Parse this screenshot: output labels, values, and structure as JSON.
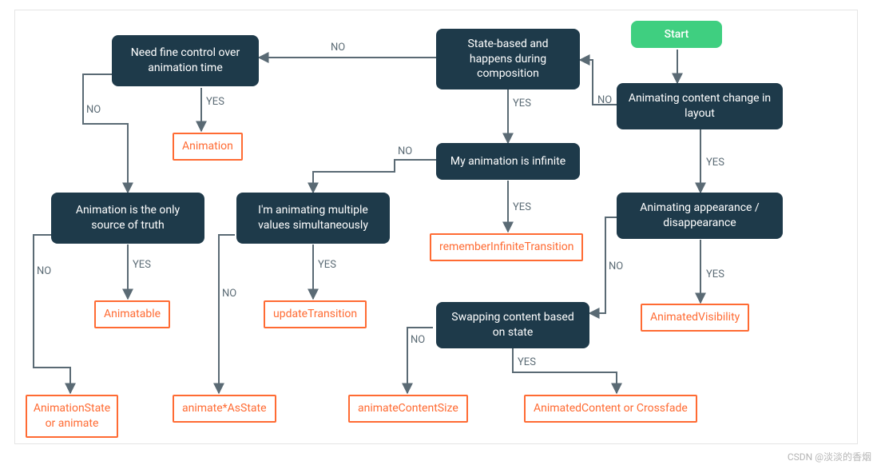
{
  "chart_data": {
    "type": "flowchart",
    "title": "",
    "nodes": [
      {
        "id": "start",
        "kind": "start",
        "text": "Start"
      },
      {
        "id": "q_layout",
        "kind": "question",
        "text": "Animating content change in layout"
      },
      {
        "id": "q_statebased",
        "kind": "question",
        "text": "State-based and happens during composition"
      },
      {
        "id": "q_appear",
        "kind": "question",
        "text": "Animating appearance / disappearance"
      },
      {
        "id": "q_swap",
        "kind": "question",
        "text": "Swapping content based on state"
      },
      {
        "id": "q_infinite",
        "kind": "question",
        "text": "My animation is infinite"
      },
      {
        "id": "q_multi",
        "kind": "question",
        "text": "I'm animating multiple values simultaneously"
      },
      {
        "id": "q_finetime",
        "kind": "question",
        "text": "Need fine control over animation time"
      },
      {
        "id": "q_onlytruth",
        "kind": "question",
        "text": "Animation is the only source of truth"
      },
      {
        "id": "a_animvis",
        "kind": "answer",
        "text": "AnimatedVisibility"
      },
      {
        "id": "a_contentcross",
        "kind": "answer",
        "text": "AnimatedContent or Crossfade"
      },
      {
        "id": "a_contentsize",
        "kind": "answer",
        "text": "animateContentSize"
      },
      {
        "id": "a_reminf",
        "kind": "answer",
        "text": "rememberInfiniteTransition"
      },
      {
        "id": "a_updatetrans",
        "kind": "answer",
        "text": "updateTransition"
      },
      {
        "id": "a_asstate",
        "kind": "answer",
        "text": "animate*AsState"
      },
      {
        "id": "a_animation",
        "kind": "answer",
        "text": "Animation"
      },
      {
        "id": "a_animatable",
        "kind": "answer",
        "text": "Animatable"
      },
      {
        "id": "a_animstate",
        "kind": "answer",
        "text": "AnimationState or animate"
      }
    ],
    "edges": [
      {
        "from": "start",
        "to": "q_layout",
        "label": ""
      },
      {
        "from": "q_layout",
        "to": "q_appear",
        "label": "YES"
      },
      {
        "from": "q_layout",
        "to": "q_statebased",
        "label": "NO"
      },
      {
        "from": "q_appear",
        "to": "a_animvis",
        "label": "YES"
      },
      {
        "from": "q_appear",
        "to": "q_swap",
        "label": "NO"
      },
      {
        "from": "q_swap",
        "to": "a_contentcross",
        "label": "YES"
      },
      {
        "from": "q_swap",
        "to": "a_contentsize",
        "label": "NO"
      },
      {
        "from": "q_statebased",
        "to": "q_infinite",
        "label": "YES"
      },
      {
        "from": "q_statebased",
        "to": "q_finetime",
        "label": "NO"
      },
      {
        "from": "q_infinite",
        "to": "a_reminf",
        "label": "YES"
      },
      {
        "from": "q_infinite",
        "to": "q_multi",
        "label": "NO"
      },
      {
        "from": "q_multi",
        "to": "a_updatetrans",
        "label": "YES"
      },
      {
        "from": "q_multi",
        "to": "a_asstate",
        "label": "NO"
      },
      {
        "from": "q_finetime",
        "to": "a_animation",
        "label": "YES"
      },
      {
        "from": "q_finetime",
        "to": "q_onlytruth",
        "label": "NO"
      },
      {
        "from": "q_onlytruth",
        "to": "a_animatable",
        "label": "YES"
      },
      {
        "from": "q_onlytruth",
        "to": "a_animstate",
        "label": "NO"
      }
    ]
  },
  "labels": {
    "yes": "YES",
    "no": "NO"
  },
  "watermark": "CSDN @淡淡的香烟"
}
